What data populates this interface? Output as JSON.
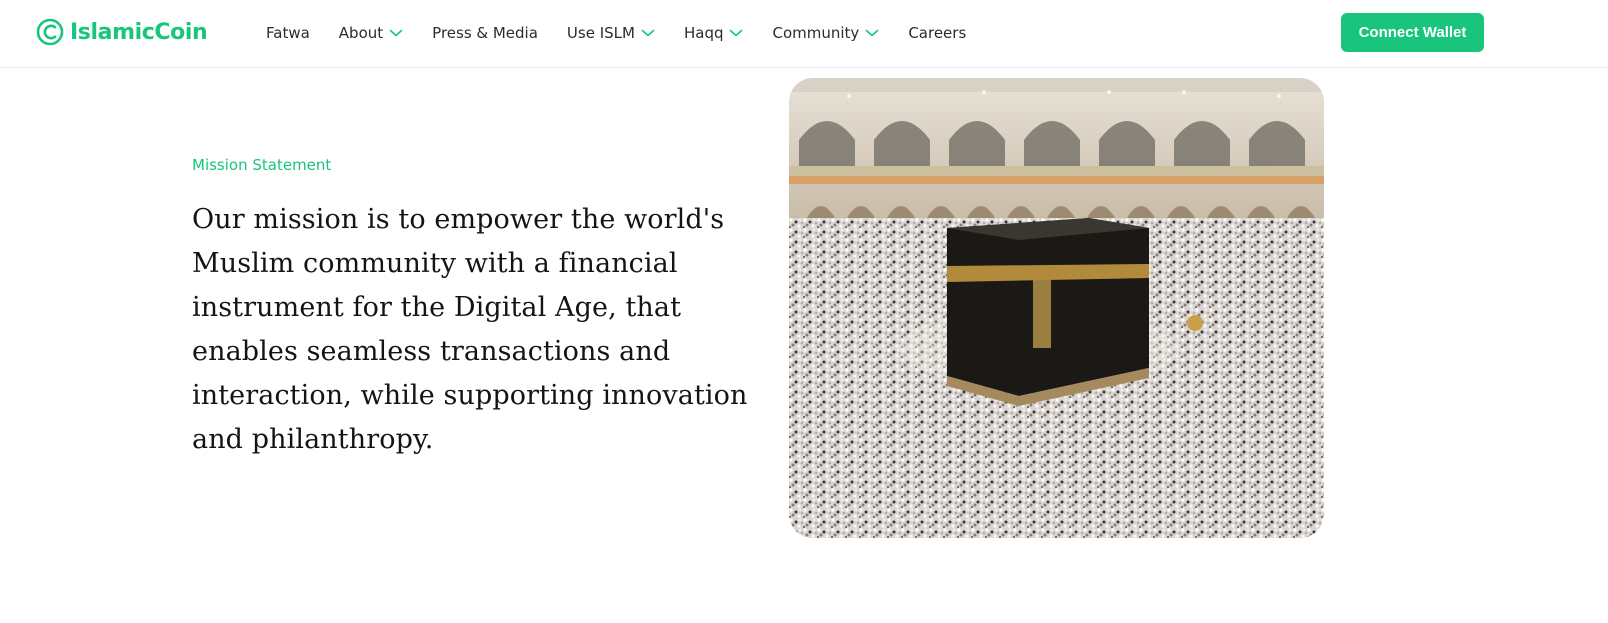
{
  "brand": {
    "name": "IslamicCoin",
    "color": "#19c57c"
  },
  "nav": {
    "items": [
      {
        "label": "Fatwa",
        "dropdown": false
      },
      {
        "label": "About",
        "dropdown": true
      },
      {
        "label": "Press & Media",
        "dropdown": false
      },
      {
        "label": "Use ISLM",
        "dropdown": true
      },
      {
        "label": "Haqq",
        "dropdown": true
      },
      {
        "label": "Community",
        "dropdown": true
      },
      {
        "label": "Careers",
        "dropdown": false
      }
    ],
    "chevron_icon": "chevron-down-icon"
  },
  "header": {
    "connect_label": "Connect Wallet"
  },
  "mission": {
    "eyebrow": "Mission Statement",
    "statement": "Our mission is to empower the world's Muslim community with a financial instrument for the Digital Age, that enables seamless transactions and interaction, while supporting innovation and philanthropy."
  },
  "image": {
    "subject": "kaaba-crowd-photo"
  }
}
